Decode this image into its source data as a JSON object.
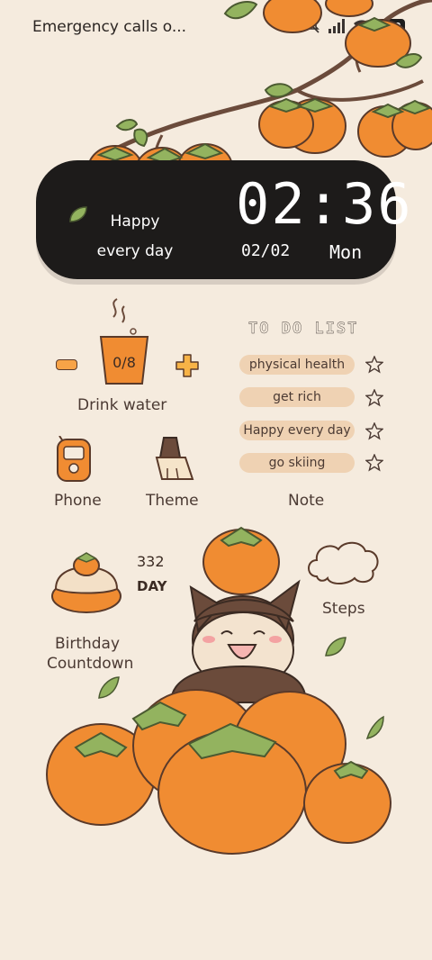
{
  "status_bar": {
    "text": "Emergency calls o...",
    "battery": "100",
    "icons": [
      "bell-muted-icon",
      "signal-icon",
      "wifi-icon",
      "battery-icon"
    ]
  },
  "clock_widget": {
    "time": "02:36",
    "date": "02/02",
    "weekday": "Mon",
    "message_line1": "Happy",
    "message_line2": "every day"
  },
  "water_widget": {
    "count": "0/8",
    "minus_label": "−",
    "plus_label": "+",
    "label": "Drink water"
  },
  "todo_widget": {
    "title": "TO DO LIST",
    "items": [
      {
        "label": "physical health"
      },
      {
        "label": "get rich"
      },
      {
        "label": "Happy every day"
      },
      {
        "label": "go skiing"
      }
    ]
  },
  "apps": {
    "phone": "Phone",
    "theme": "Theme",
    "note": "Note",
    "steps": "Steps"
  },
  "birthday_widget": {
    "days": "332",
    "unit": "DAY",
    "label_line1": "Birthday",
    "label_line2": "Countdown"
  },
  "colors": {
    "background": "#f5ebde",
    "accent_orange": "#f08c32",
    "leaf_green": "#93b35f",
    "card_dark": "#1d1b1a"
  }
}
